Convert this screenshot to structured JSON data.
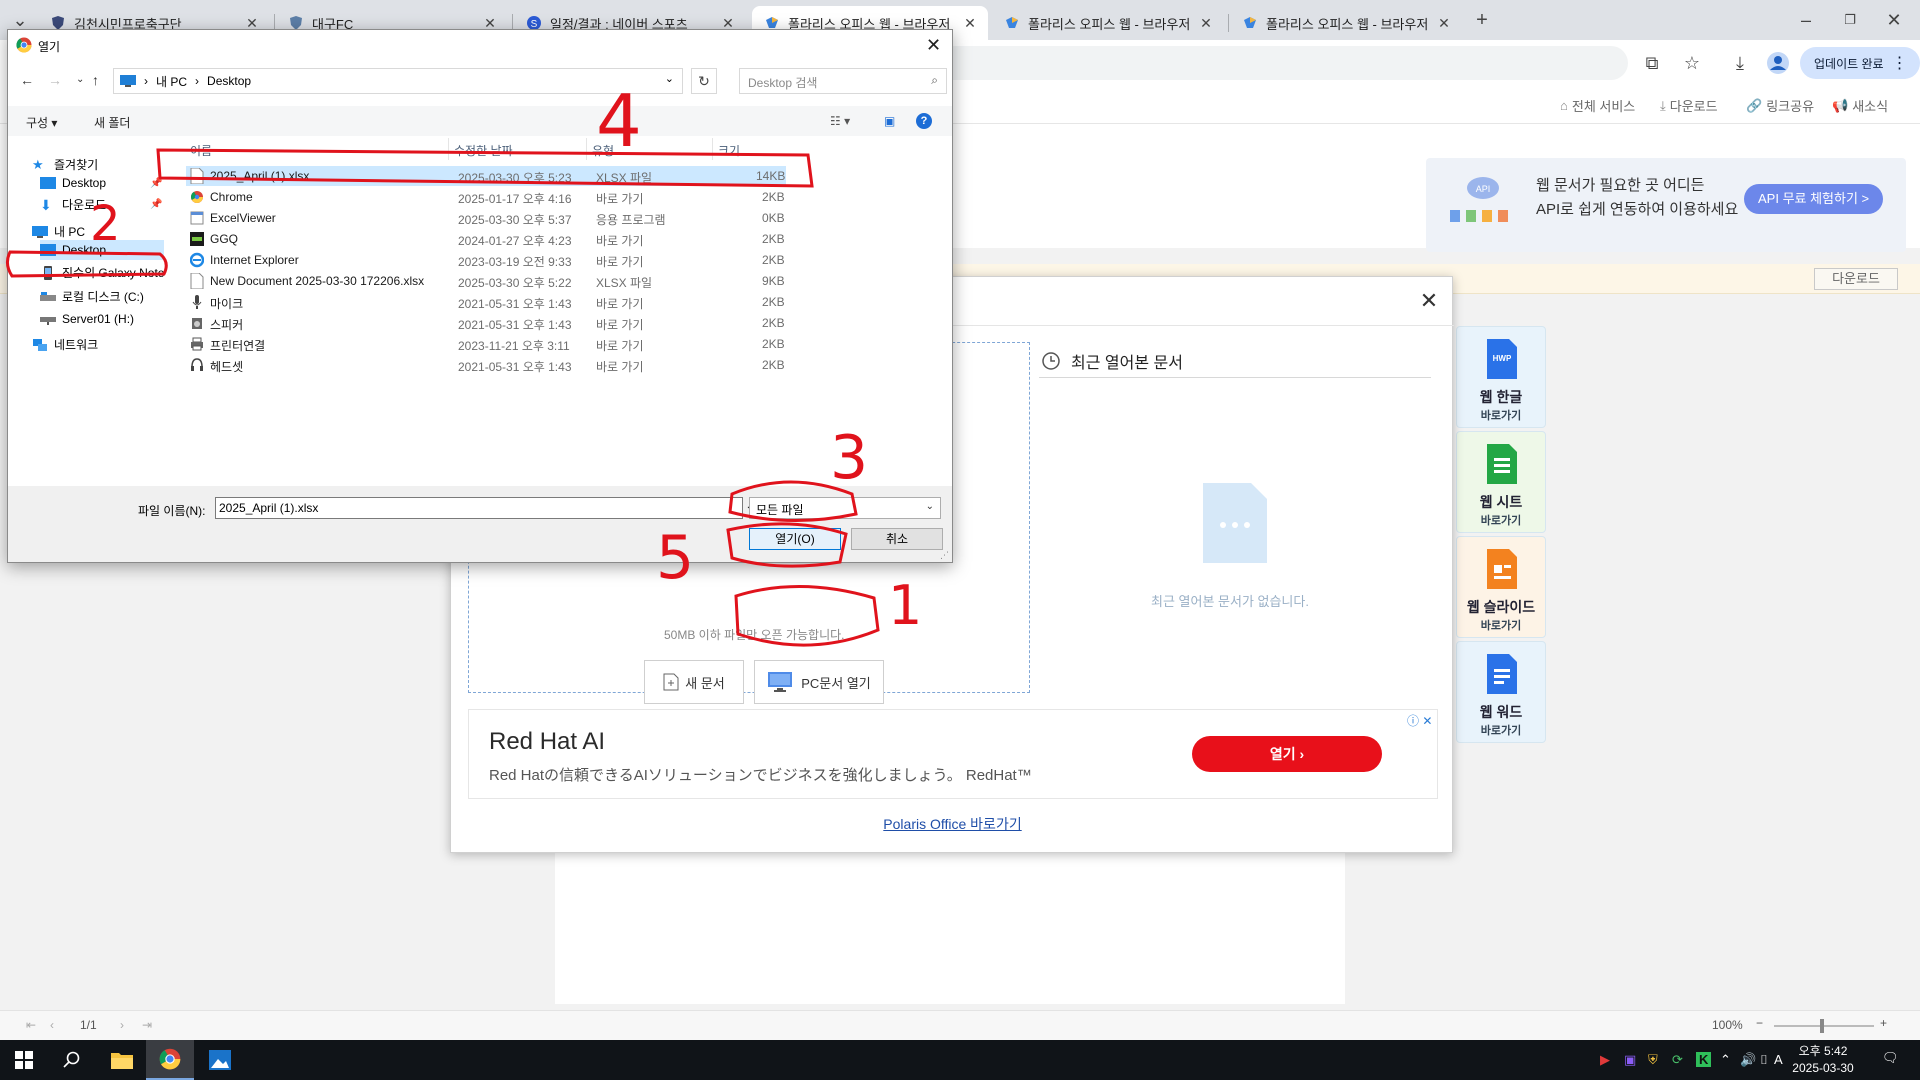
{
  "browser": {
    "tabs": [
      {
        "title": "김천시민프로축구단"
      },
      {
        "title": "대구FC"
      },
      {
        "title": "일정/결과 : 네이버 스포츠"
      },
      {
        "title": "폴라리스 오피스 웹 - 브라우저"
      },
      {
        "title": "폴라리스 오피스 웹 - 브라우저"
      },
      {
        "title": "폴라리스 오피스 웹 - 브라우저"
      }
    ],
    "update_label": "업데이트 완료"
  },
  "site_header": {
    "links": [
      "전체 서비스",
      "다운로드",
      "링크공유",
      "새소식"
    ]
  },
  "api_banner": {
    "line1": "웹 문서가 필요한 곳 어디든",
    "line2": "API로 쉽게 연동하여 이용하세요",
    "button": "API 무료 체험하기 >",
    "cloud_label": "API"
  },
  "notice": {
    "download_label": "다운로드"
  },
  "apps": [
    {
      "name": "웹 한글",
      "go": "바로가기",
      "icon": "hwp-icon",
      "badge": "HWP",
      "color": "#2a72e8",
      "bg": "#e8f3fb"
    },
    {
      "name": "웹 시트",
      "go": "바로가기",
      "icon": "sheet-icon",
      "badge": "",
      "color": "#23a745",
      "bg": "#eef8e8"
    },
    {
      "name": "웹 슬라이드",
      "go": "바로가기",
      "icon": "slide-icon",
      "badge": "",
      "color": "#f3821f",
      "bg": "#fdf3e6"
    },
    {
      "name": "웹 워드",
      "go": "바로가기",
      "icon": "word-icon",
      "badge": "",
      "color": "#2a72e8",
      "bg": "#e8f3fb"
    }
  ],
  "modal": {
    "size_note": "50MB 이하 파일만 오픈 가능합니다.",
    "new_doc": "새 문서",
    "open_pc": "PC문서 열기",
    "recent_title": "최근 열어본 문서",
    "recent_empty": "최근 열어본 문서가 없습니다.",
    "ad": {
      "title": "Red Hat AI",
      "subtitle": "Red Hatの信頼できるAIソリューションでビジネスを強化しましょう。 RedHat™",
      "button": "열기",
      "info": "ⓘ ✕"
    },
    "footer_link": "Polaris Office 바로가기"
  },
  "status_bar": {
    "page": "1/1",
    "zoom": "100%"
  },
  "dialog": {
    "title": "열기",
    "address": [
      "내 PC",
      "Desktop"
    ],
    "search_placeholder": "Desktop 검색",
    "cmd_organize": "구성 ▾",
    "cmd_new_folder": "새 폴더",
    "nav": [
      {
        "label": "즐겨찾기",
        "icon": "star-icon"
      },
      {
        "label": "Desktop",
        "icon": "desktop-icon"
      },
      {
        "label": "다운로드",
        "icon": "download-icon"
      },
      {
        "label": "내 PC",
        "icon": "pc-icon"
      },
      {
        "label": "Desktop",
        "icon": "desktop-icon"
      },
      {
        "label": "진수의 Galaxy Note",
        "icon": "phone-icon"
      },
      {
        "label": "로컬 디스크 (C:)",
        "icon": "drive-icon"
      },
      {
        "label": "Server01 (H:)",
        "icon": "network-drive-icon"
      },
      {
        "label": "네트워크",
        "icon": "network-icon"
      }
    ],
    "columns": [
      "이름",
      "수정한 날짜",
      "유형",
      "크기"
    ],
    "files": [
      {
        "name": "2025_April (1).xlsx",
        "date": "2025-03-30 오후 5:23",
        "type": "XLSX 파일",
        "size": "14KB"
      },
      {
        "name": "Chrome",
        "date": "2025-01-17 오후 4:16",
        "type": "바로 가기",
        "size": "2KB"
      },
      {
        "name": "ExcelViewer",
        "date": "2025-03-30 오후 5:37",
        "type": "응용 프로그램",
        "size": "0KB"
      },
      {
        "name": "GGQ",
        "date": "2024-01-27 오후 4:23",
        "type": "바로 가기",
        "size": "2KB"
      },
      {
        "name": "Internet Explorer",
        "date": "2023-03-19 오전 9:33",
        "type": "바로 가기",
        "size": "2KB"
      },
      {
        "name": "New Document 2025-03-30 172206.xlsx",
        "date": "2025-03-30 오후 5:22",
        "type": "XLSX 파일",
        "size": "9KB"
      },
      {
        "name": "마이크",
        "date": "2021-05-31 오후 1:43",
        "type": "바로 가기",
        "size": "2KB"
      },
      {
        "name": "스피커",
        "date": "2021-05-31 오후 1:43",
        "type": "바로 가기",
        "size": "2KB"
      },
      {
        "name": "프린터연결",
        "date": "2023-11-21 오후 3:11",
        "type": "바로 가기",
        "size": "2KB"
      },
      {
        "name": "헤드셋",
        "date": "2021-05-31 오후 1:43",
        "type": "바로 가기",
        "size": "2KB"
      }
    ],
    "filename_label": "파일 이름(N):",
    "filename_value": "2025_April (1).xlsx",
    "filetype": "모든 파일",
    "open_button": "열기(O)",
    "cancel_button": "취소"
  },
  "annotations": [
    "1",
    "2",
    "3",
    "4",
    "5"
  ],
  "taskbar": {
    "time": "오후 5:42",
    "date": "2025-03-30",
    "ime": "A"
  }
}
